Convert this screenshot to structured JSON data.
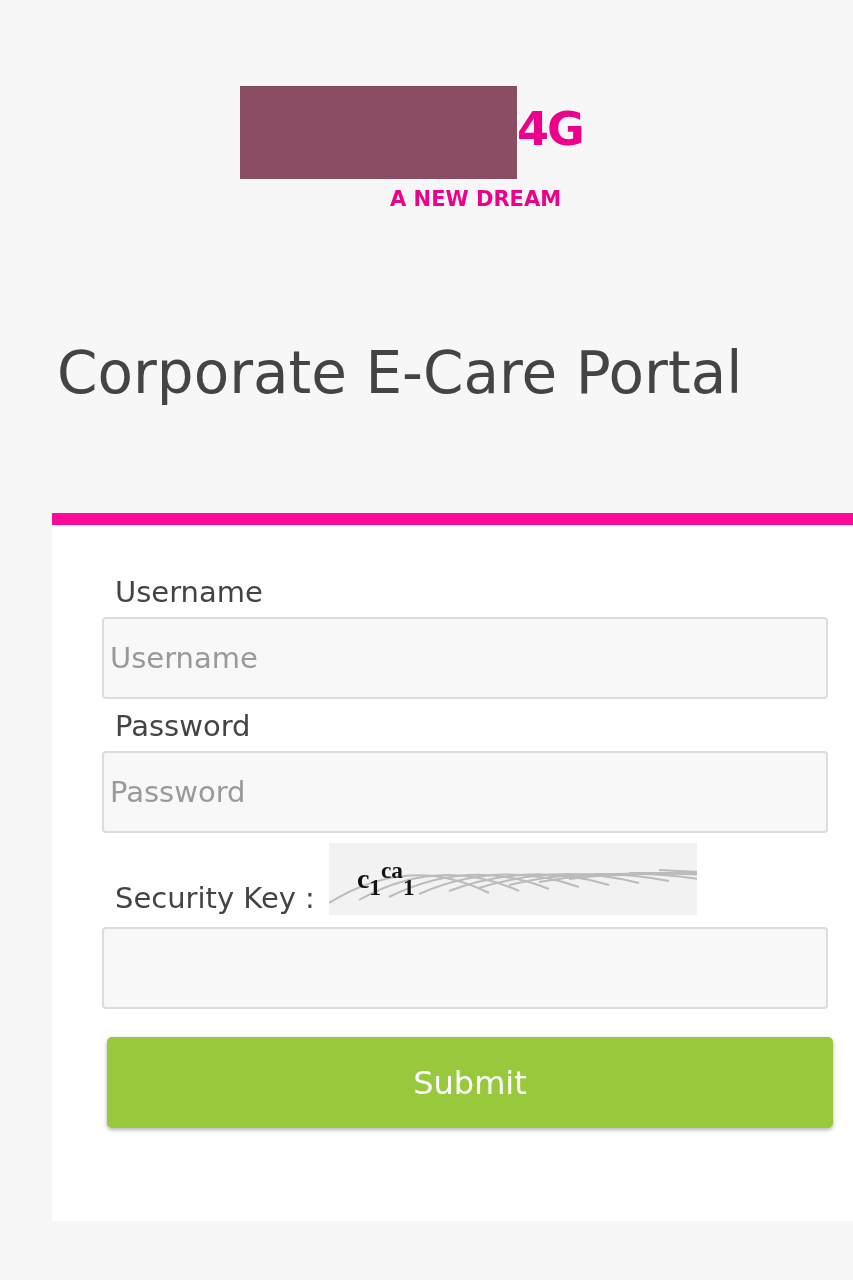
{
  "logo": {
    "badge": "4G",
    "tagline": "A NEW DREAM"
  },
  "title": "Corporate E-Care Portal",
  "form": {
    "fields": [
      {
        "label": "Username",
        "placeholder": "Username",
        "kind": "text"
      },
      {
        "label": "Password",
        "placeholder": "Password",
        "kind": "password"
      },
      {
        "label": "Security Key :",
        "kind": "captcha",
        "captcha": "c$_{1}$$^{ca}$$_{1}$"
      }
    ],
    "submit": "Submit"
  }
}
